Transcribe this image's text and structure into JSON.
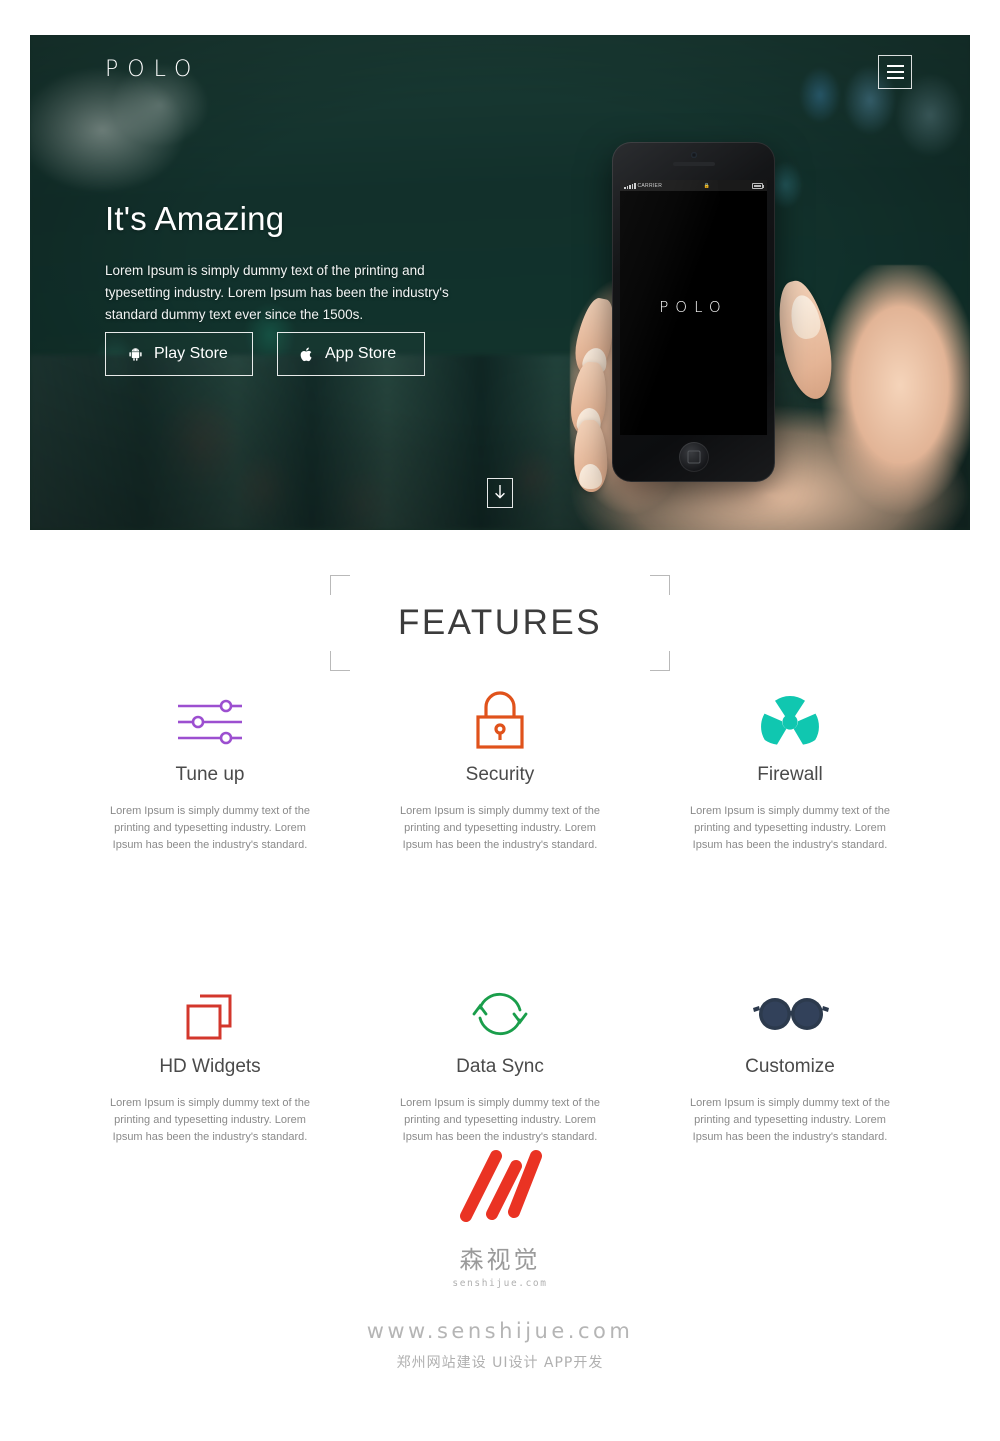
{
  "hero": {
    "logo": "POLO",
    "menu_icon": "hamburger-icon",
    "title": "It's Amazing",
    "subtitle": "Lorem Ipsum is simply dummy text of the printing and typesetting industry. Lorem Ipsum has been the industry's standard dummy text ever since the 1500s.",
    "buttons": [
      {
        "label": "Play Store",
        "icon": "android-icon"
      },
      {
        "label": "App Store",
        "icon": "apple-icon"
      }
    ],
    "scroll_icon": "download-arrow-icon",
    "phone": {
      "carrier": "CARRIER",
      "screen_logo": "POLO"
    }
  },
  "features": {
    "heading": "FEATURES",
    "items": [
      {
        "title": "Tune up",
        "icon": "sliders-icon",
        "color": "#9c4fd0",
        "text": "Lorem Ipsum is simply dummy text of the printing and typesetting industry. Lorem Ipsum has been the industry's standard."
      },
      {
        "title": "Security",
        "icon": "lock-icon",
        "color": "#e0521b",
        "text": "Lorem Ipsum is simply dummy text of the printing and typesetting industry. Lorem Ipsum has been the industry's standard."
      },
      {
        "title": "Firewall",
        "icon": "radiation-icon",
        "color": "#10c7b0",
        "text": "Lorem Ipsum is simply dummy text of the printing and typesetting industry. Lorem Ipsum has been the industry's standard."
      },
      {
        "title": "HD Widgets",
        "icon": "windows-squares-icon",
        "color": "#d3372c",
        "text": "Lorem Ipsum is simply dummy text of the printing and typesetting industry. Lorem Ipsum has been the industry's standard."
      },
      {
        "title": "Data Sync",
        "icon": "sync-arrows-icon",
        "color": "#1a9e4b",
        "text": "Lorem Ipsum is simply dummy text of the printing and typesetting industry. Lorem Ipsum has been the industry's standard."
      },
      {
        "title": "Customize",
        "icon": "sunglasses-icon",
        "color": "#2c3a4d",
        "text": "Lorem Ipsum is simply dummy text of the printing and typesetting industry. Lorem Ipsum has been the industry's standard."
      }
    ]
  },
  "footer": {
    "watermark_logo": "senshijue-logo-icon",
    "watermark_cn": "森视觉",
    "watermark_url": "senshijue.com",
    "site_url": "www.senshijue.com",
    "tagline": "郑州网站建设 UI设计 APP开发",
    "logo_color": "#ea3323"
  }
}
